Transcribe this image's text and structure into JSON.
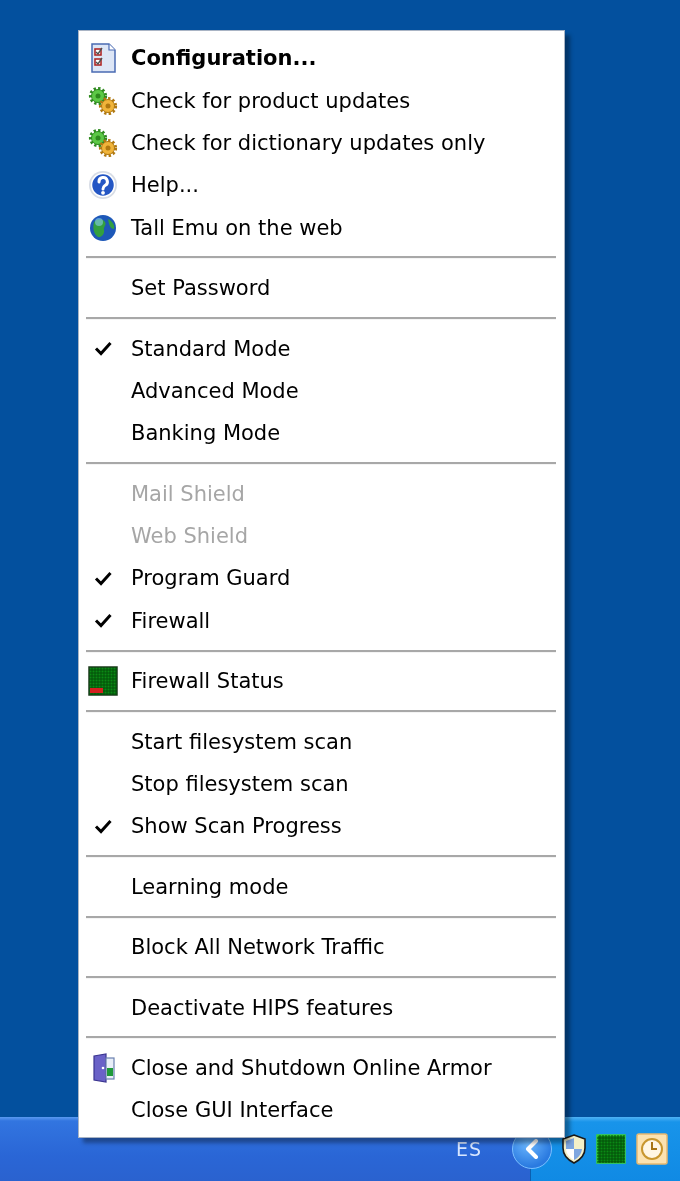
{
  "menu": {
    "sections": [
      {
        "items": [
          {
            "label": "Configuration...",
            "default": true,
            "checked": false,
            "disabled": false
          },
          {
            "label": "Check for product updates",
            "default": false,
            "checked": false,
            "disabled": false
          },
          {
            "label": "Check for dictionary updates only",
            "default": false,
            "checked": false,
            "disabled": false
          },
          {
            "label": "Help...",
            "default": false,
            "checked": false,
            "disabled": false
          },
          {
            "label": "Tall Emu on the web",
            "default": false,
            "checked": false,
            "disabled": false
          }
        ]
      },
      {
        "items": [
          {
            "label": "Set Password",
            "default": false,
            "checked": false,
            "disabled": false
          }
        ]
      },
      {
        "items": [
          {
            "label": "Standard Mode",
            "default": false,
            "checked": true,
            "disabled": false
          },
          {
            "label": "Advanced Mode",
            "default": false,
            "checked": false,
            "disabled": false
          },
          {
            "label": "Banking Mode",
            "default": false,
            "checked": false,
            "disabled": false
          }
        ]
      },
      {
        "items": [
          {
            "label": "Mail Shield",
            "default": false,
            "checked": false,
            "disabled": true
          },
          {
            "label": "Web Shield",
            "default": false,
            "checked": false,
            "disabled": true
          },
          {
            "label": "Program Guard",
            "default": false,
            "checked": true,
            "disabled": false
          },
          {
            "label": "Firewall",
            "default": false,
            "checked": true,
            "disabled": false
          }
        ]
      },
      {
        "items": [
          {
            "label": "Firewall Status",
            "default": false,
            "checked": false,
            "disabled": false
          }
        ]
      },
      {
        "items": [
          {
            "label": "Start filesystem scan",
            "default": false,
            "checked": false,
            "disabled": false
          },
          {
            "label": "Stop filesystem scan",
            "default": false,
            "checked": false,
            "disabled": false
          },
          {
            "label": "Show Scan Progress",
            "default": false,
            "checked": true,
            "disabled": false
          }
        ]
      },
      {
        "items": [
          {
            "label": "Learning mode",
            "default": false,
            "checked": false,
            "disabled": false
          }
        ]
      },
      {
        "items": [
          {
            "label": "Block All Network Traffic",
            "default": false,
            "checked": false,
            "disabled": false
          }
        ]
      },
      {
        "items": [
          {
            "label": "Deactivate HIPS features",
            "default": false,
            "checked": false,
            "disabled": false
          }
        ]
      },
      {
        "items": [
          {
            "label": "Close and Shutdown Online Armor",
            "default": false,
            "checked": false,
            "disabled": false
          },
          {
            "label": "Close GUI Interface",
            "default": false,
            "checked": false,
            "disabled": false
          }
        ]
      }
    ]
  },
  "taskbar": {
    "language": "ES"
  }
}
